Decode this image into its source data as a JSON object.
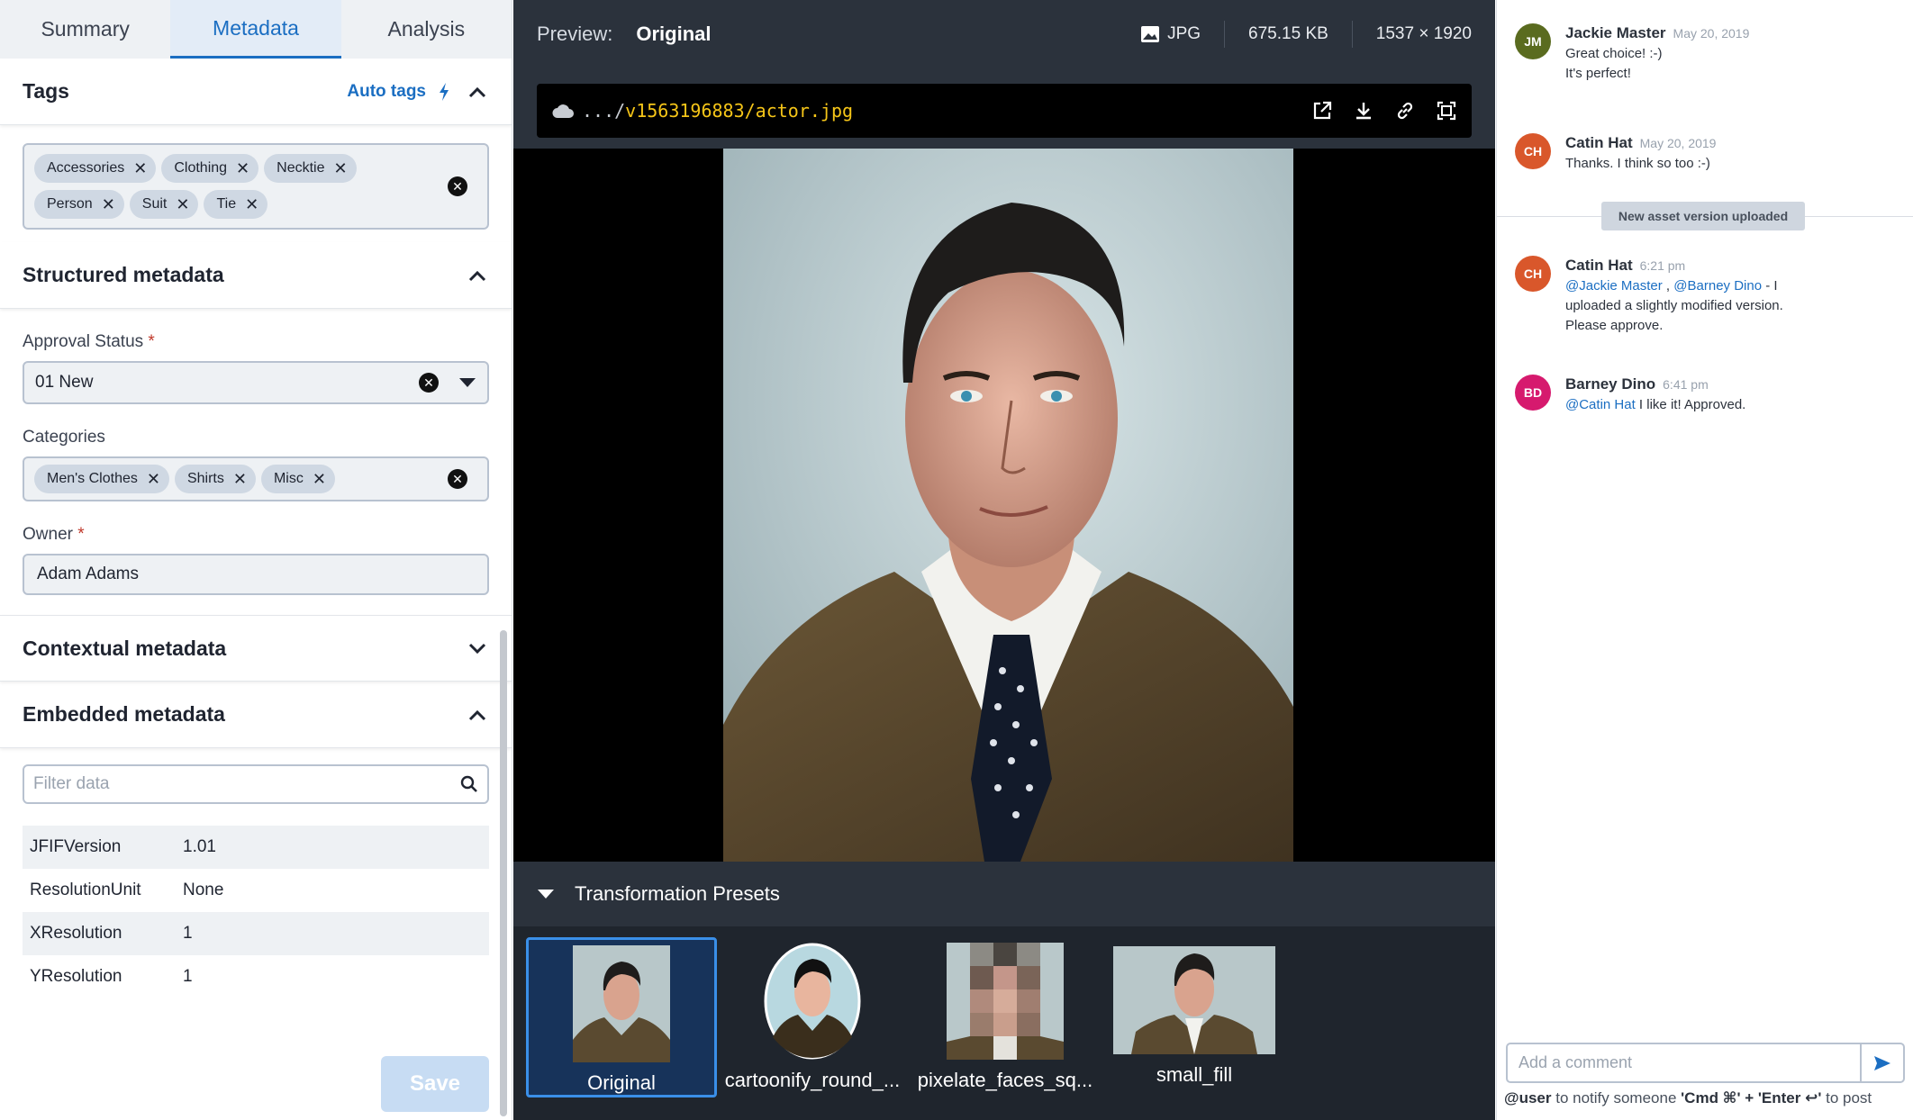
{
  "tabs": [
    {
      "label": "Summary"
    },
    {
      "label": "Metadata"
    },
    {
      "label": "Analysis"
    }
  ],
  "tags_section": {
    "title": "Tags",
    "auto_tags_label": "Auto tags",
    "chips": [
      "Accessories",
      "Clothing",
      "Necktie",
      "Person",
      "Suit",
      "Tie"
    ]
  },
  "structured": {
    "title": "Structured metadata",
    "approval_label": "Approval Status",
    "approval_value": "01 New",
    "categories_label": "Categories",
    "categories": [
      "Men's Clothes",
      "Shirts",
      "Misc"
    ],
    "owner_label": "Owner",
    "owner_value": "Adam Adams",
    "required_mark": "*"
  },
  "contextual": {
    "title": "Contextual metadata"
  },
  "embedded": {
    "title": "Embedded metadata",
    "filter_placeholder": "Filter data",
    "rows": [
      {
        "key": "JFIFVersion",
        "value": "1.01"
      },
      {
        "key": "ResolutionUnit",
        "value": "None"
      },
      {
        "key": "XResolution",
        "value": "1"
      },
      {
        "key": "YResolution",
        "value": "1"
      }
    ]
  },
  "save_label": "Save",
  "preview": {
    "label": "Preview:",
    "value": "Original",
    "format": "JPG",
    "size": "675.15 KB",
    "dimensions": "1537 × 1920",
    "path_prefix": ".../",
    "path": "v1563196883/actor.jpg"
  },
  "presets": {
    "title": "Transformation Presets",
    "items": [
      {
        "label": "Original"
      },
      {
        "label": "cartoonify_round_..."
      },
      {
        "label": "pixelate_faces_sq..."
      },
      {
        "label": "small_fill"
      }
    ]
  },
  "comments": [
    {
      "initials": "JM",
      "name": "Jackie Master",
      "time": "May 20, 2019",
      "line1": "Great choice! :-)",
      "line2": "It's perfect!",
      "color": "#5a6b1f"
    },
    {
      "initials": "CH",
      "name": "Catin Hat",
      "time": "May 20, 2019",
      "line1": "Thanks. I think so too :-)",
      "color": "#d9572b"
    },
    {
      "initials": "CH",
      "name": "Catin Hat",
      "time": "6:21 pm",
      "mention1": "@Jackie Master",
      "sep": " , ",
      "mention2": "@Barney Dino",
      "text_after": " - I",
      "line2": "uploaded a slightly modified version.",
      "line3": "Please approve.",
      "color": "#d9572b"
    },
    {
      "initials": "BD",
      "name": "Barney Dino",
      "time": "6:41 pm",
      "mention1": "@Catin Hat",
      "text_after": " I like it! Approved.",
      "color": "#d61a6e"
    }
  ],
  "version_divider": "New asset version uploaded",
  "compose_placeholder": "Add a comment",
  "hint": {
    "user": "@user",
    "notify": " to notify someone  ",
    "keys": "'Cmd ⌘' + 'Enter ↩'",
    "post": " to post"
  },
  "colors": {
    "accent": "#1b6ec2",
    "dark_bg": "#2b323c"
  }
}
